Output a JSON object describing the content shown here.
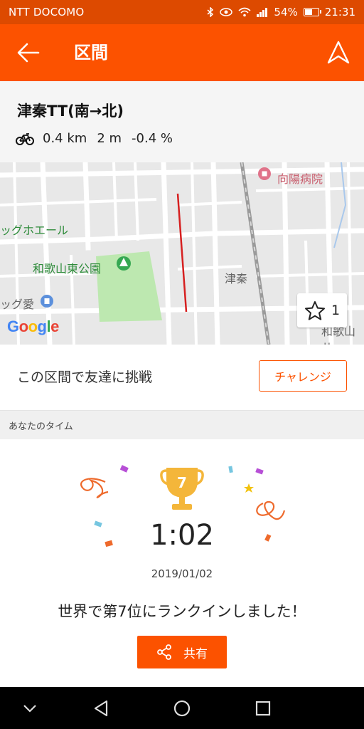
{
  "status_bar": {
    "carrier": "NTT DOCOMO",
    "battery": "54%",
    "time": "21:31"
  },
  "app_bar": {
    "title": "区間"
  },
  "segment": {
    "name": "津秦TT(南→北)",
    "distance": "0.4 km",
    "elevation": "2 m",
    "grade": "-0.4 %"
  },
  "map": {
    "labels": {
      "hospital": "向陽病院",
      "business_left": "ッグホエール",
      "park": "和歌山東公園",
      "area": "津秦",
      "drug": "ッグ愛",
      "cutoff_right": "和歌山井"
    },
    "logo": "Google",
    "star_count": "1"
  },
  "challenge": {
    "text": "この区間で友達に挑戦",
    "button": "チャレンジ"
  },
  "your_time": {
    "header": "あなたのタイム",
    "rank": "7",
    "time": "1:02",
    "date": "2019/01/02",
    "message": "世界で第7位にランクインしました！",
    "share_label": "共有"
  },
  "colors": {
    "brand": "#fc5200",
    "status_bar": "#dd4a00",
    "trophy": "#f4b63a",
    "segment_line": "#d62020",
    "park": "#bde8b0"
  }
}
